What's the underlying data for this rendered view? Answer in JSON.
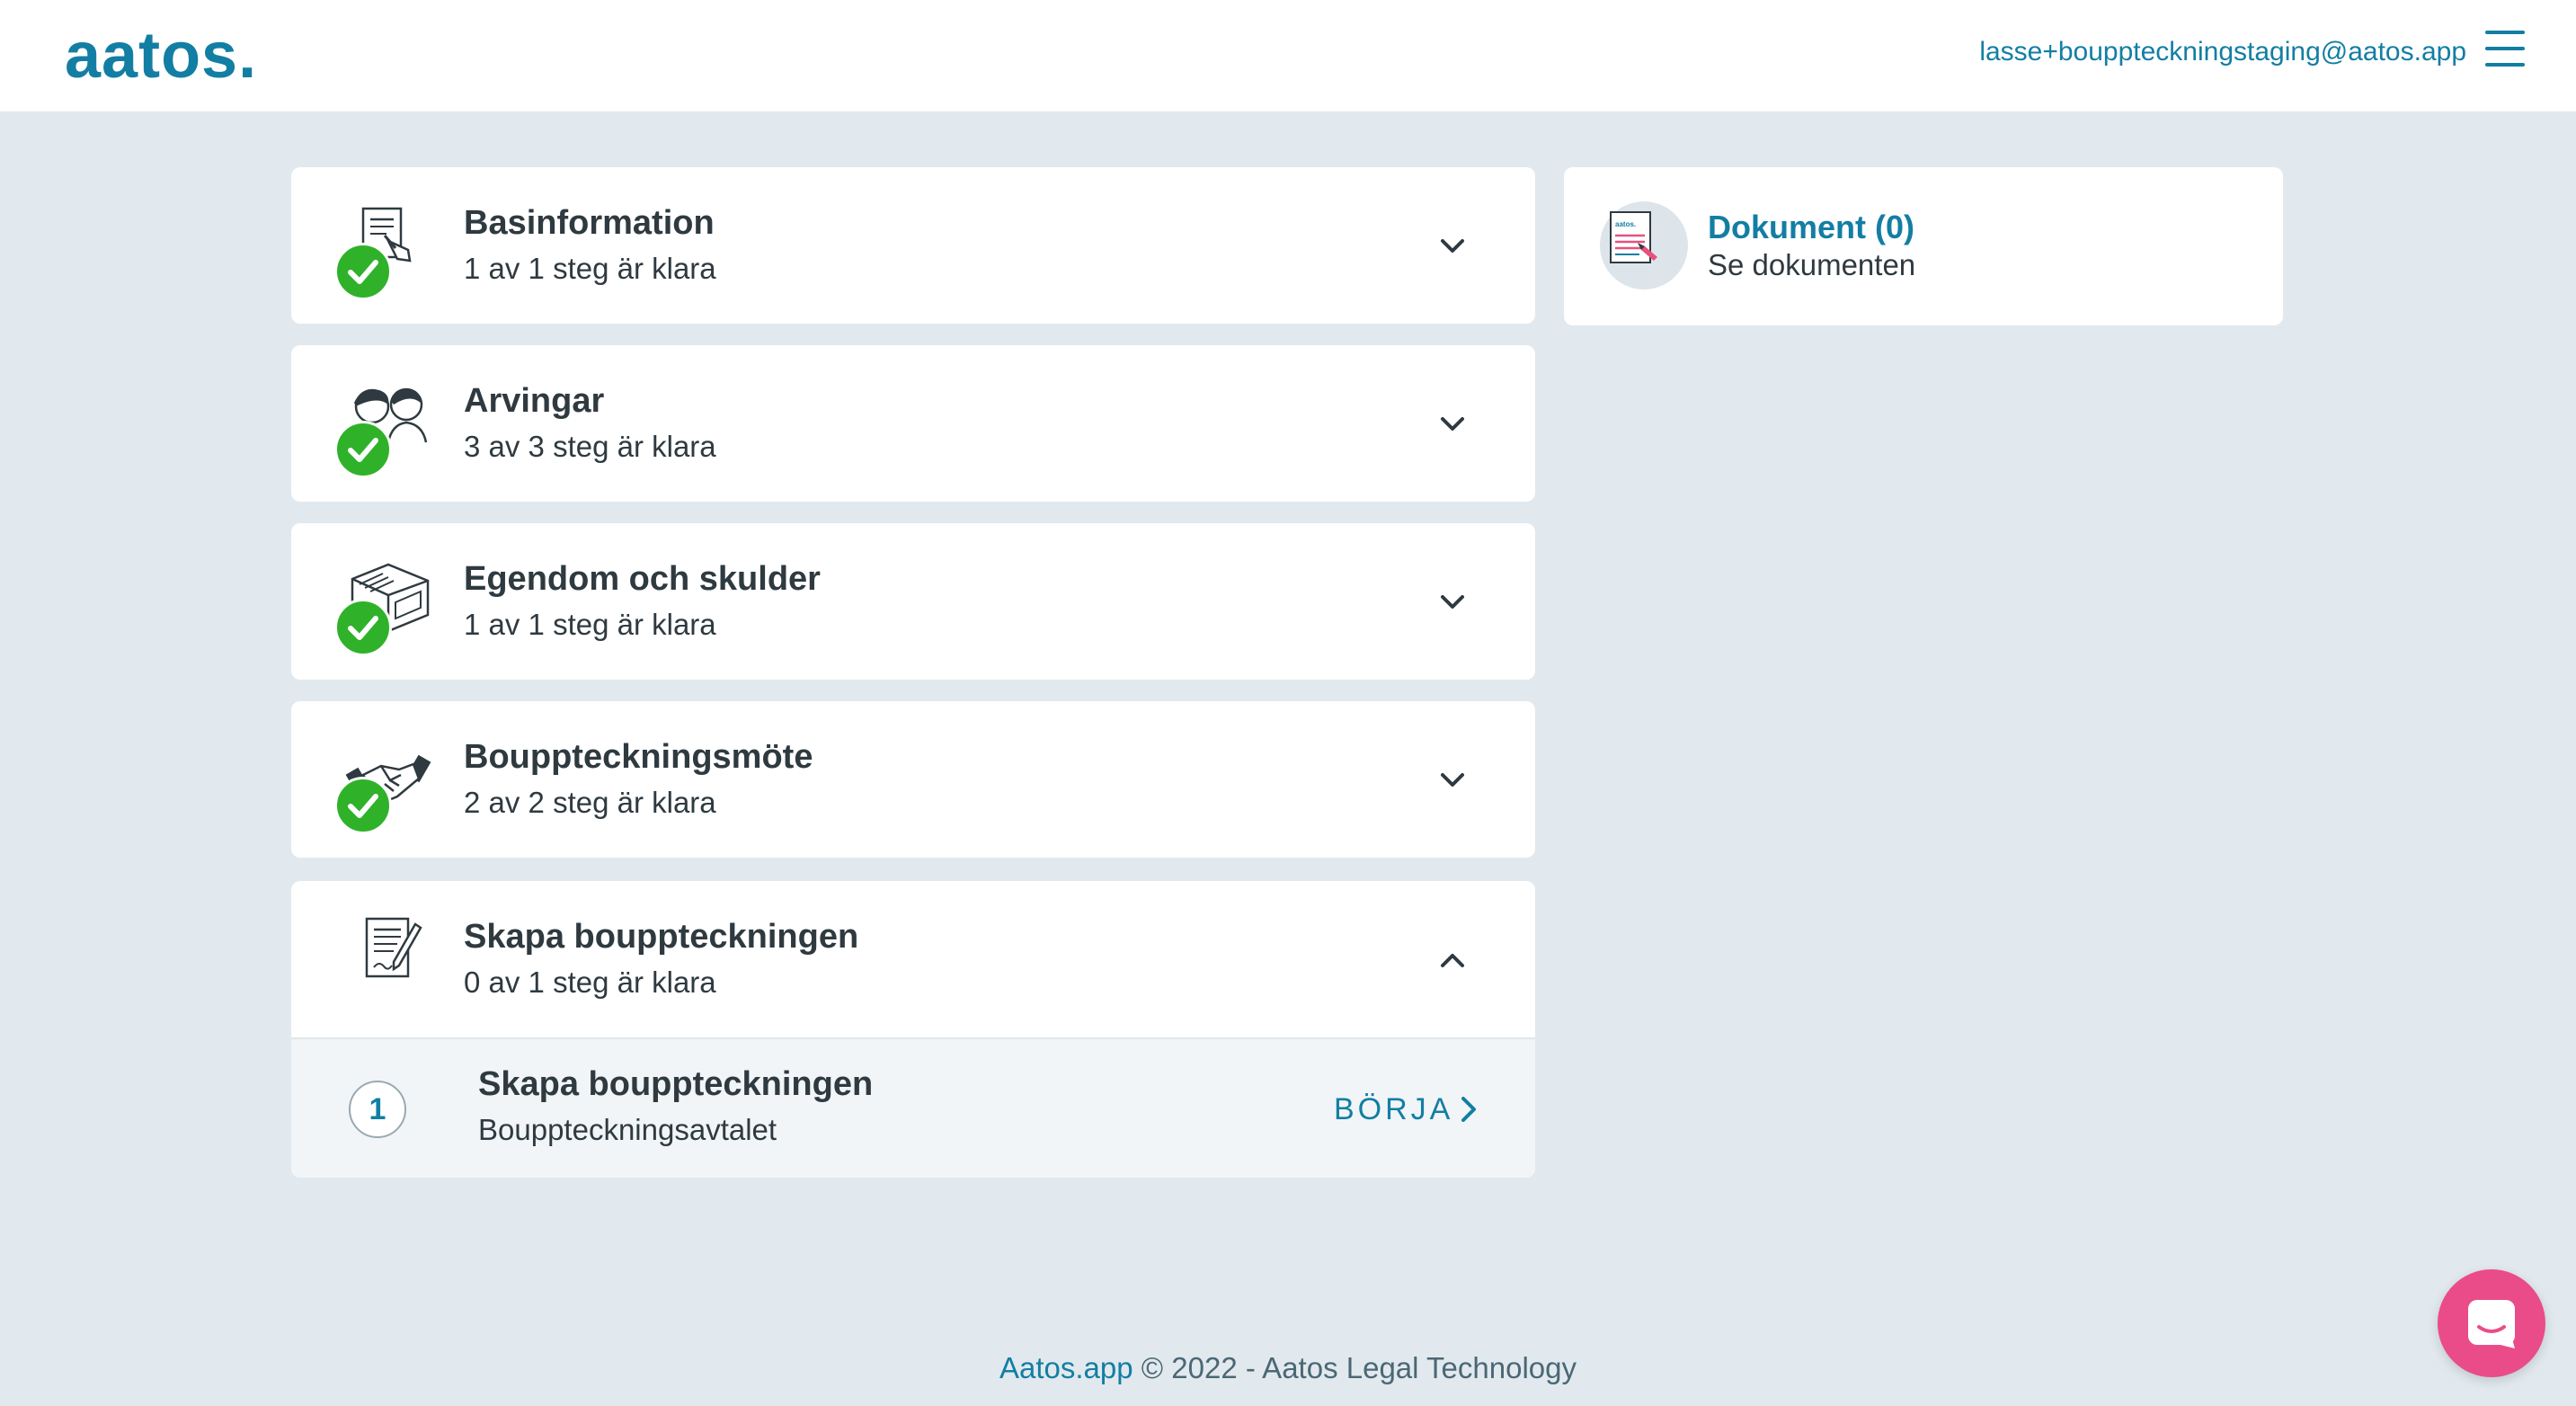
{
  "header": {
    "logo": "aatos.",
    "user_email": "lasse+bouppteckningstaging@aatos.app",
    "menu_icon": "hamburger-menu-icon"
  },
  "sections": [
    {
      "title": "Basinformation",
      "status": "1 av 1 steg är klara",
      "icon": "document-signing-icon",
      "completed": true,
      "expanded": false
    },
    {
      "title": "Arvingar",
      "status": "3 av 3 steg är klara",
      "icon": "people-icon",
      "completed": true,
      "expanded": false
    },
    {
      "title": "Egendom och skulder",
      "status": "1 av 1 steg är klara",
      "icon": "furniture-icon",
      "completed": true,
      "expanded": false
    },
    {
      "title": "Bouppteckningsmöte",
      "status": "2 av 2 steg är klara",
      "icon": "handshake-icon",
      "completed": true,
      "expanded": false
    },
    {
      "title": "Skapa bouppteckningen",
      "status": "0 av 1 steg är klara",
      "icon": "document-pen-icon",
      "completed": false,
      "expanded": true,
      "steps": [
        {
          "number": "1",
          "title": "Skapa bouppteckningen",
          "subtitle": "Bouppteckningsavtalet",
          "action": "BÖRJA"
        }
      ]
    }
  ],
  "documents": {
    "title": "Dokument (0)",
    "link": "Se dokumenten",
    "icon": "document-icon"
  },
  "footer": {
    "link": "Aatos.app",
    "text": " © 2022 - Aatos Legal Technology"
  },
  "chat": {
    "icon": "chat-icon"
  },
  "colors": {
    "brand": "#137ea3",
    "check": "#2fb22a",
    "chat": "#ea4c89",
    "background": "#e1e9ee"
  }
}
